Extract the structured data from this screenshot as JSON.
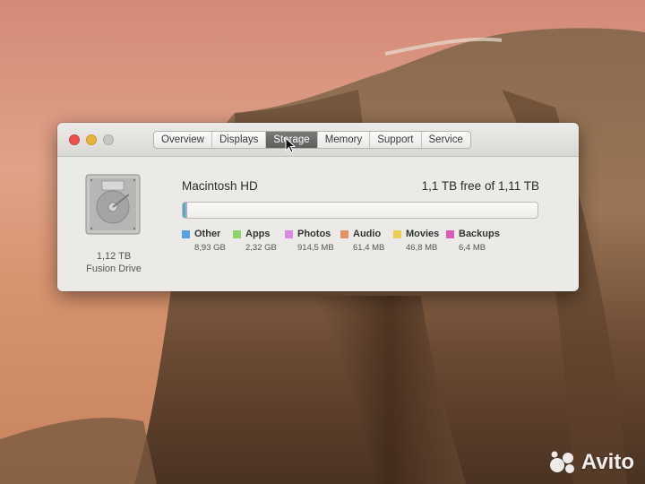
{
  "window": {
    "tabs": [
      {
        "label": "Overview",
        "active": false
      },
      {
        "label": "Displays",
        "active": false
      },
      {
        "label": "Storage",
        "active": true
      },
      {
        "label": "Memory",
        "active": false
      },
      {
        "label": "Support",
        "active": false
      },
      {
        "label": "Service",
        "active": false
      }
    ]
  },
  "disk": {
    "capacity": "1,12 TB",
    "type": "Fusion Drive"
  },
  "volume": {
    "name": "Macintosh HD",
    "free_text": "1,1 TB free of 1,11 TB"
  },
  "legend": [
    {
      "label": "Other",
      "size": "8,93 GB",
      "color": "#5b9fe0"
    },
    {
      "label": "Apps",
      "size": "2,32 GB",
      "color": "#8fd16b"
    },
    {
      "label": "Photos",
      "size": "914,5 MB",
      "color": "#d98be0"
    },
    {
      "label": "Audio",
      "size": "61,4 MB",
      "color": "#e0936a"
    },
    {
      "label": "Movies",
      "size": "46,8 MB",
      "color": "#e8cf52"
    },
    {
      "label": "Backups",
      "size": "6,4 MB",
      "color": "#d95cb5"
    }
  ],
  "watermark": {
    "text": "Avito"
  }
}
